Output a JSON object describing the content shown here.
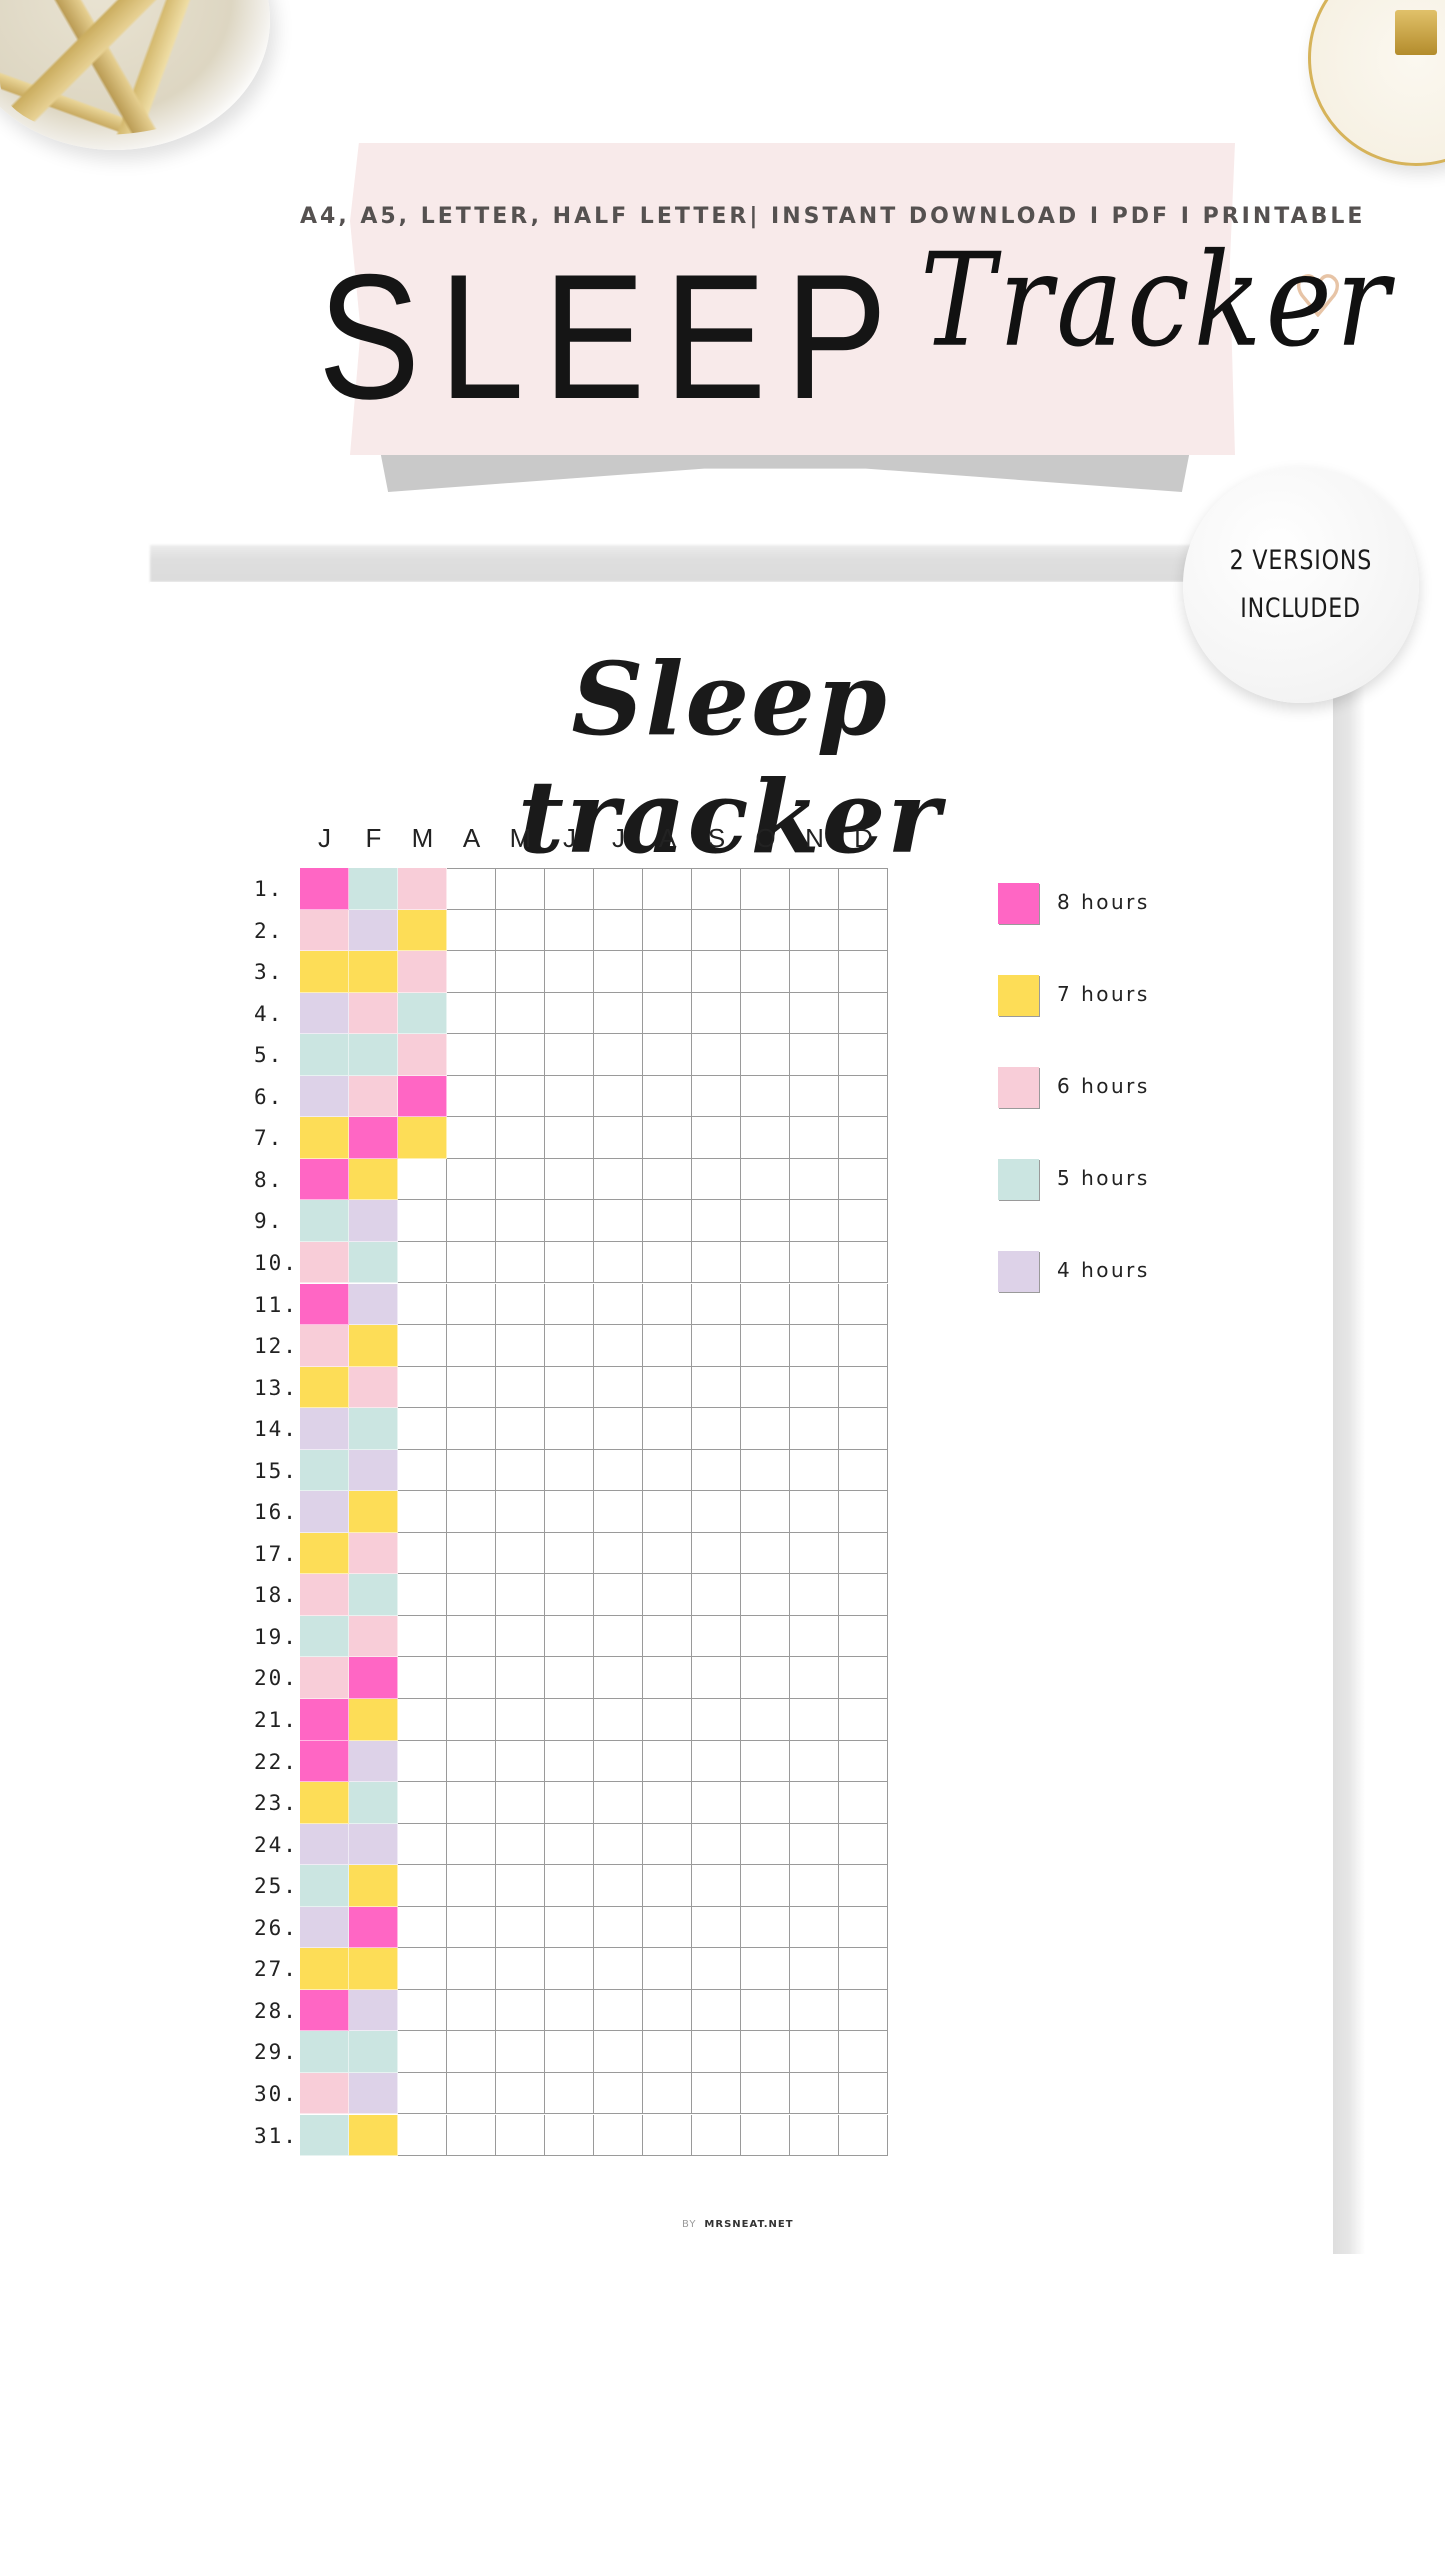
{
  "header": {
    "subtitle": "A4, A5, LETTER, HALF LETTER| INSTANT DOWNLOAD I PDF I PRINTABLE",
    "title_main": "SLEEP",
    "title_script": "Tracker"
  },
  "badge": {
    "line1": "2 Versions",
    "line2": "Included"
  },
  "decor": {
    "heart_icon": "♡"
  },
  "page": {
    "title": "Sleep tracker",
    "footer_by": "BY",
    "footer_brand": "MRSNEAT.NET"
  },
  "colors": {
    "8": "#ff66c4",
    "7": "#fddd57",
    "6": "#f8cdd8",
    "5": "#cbe5e1",
    "4": "#ddd2e8"
  },
  "chart_data": {
    "type": "heatmap",
    "title": "Sleep tracker",
    "xlabel": "",
    "ylabel": "",
    "categories": [
      "J",
      "F",
      "M",
      "A",
      "M",
      "J",
      "J",
      "A",
      "S",
      "O",
      "N",
      "D"
    ],
    "days": [
      "1.",
      "2.",
      "3.",
      "4.",
      "5.",
      "6.",
      "7.",
      "8.",
      "9.",
      "10.",
      "11.",
      "12.",
      "13.",
      "14.",
      "15.",
      "16.",
      "17.",
      "18.",
      "19.",
      "20.",
      "21.",
      "22.",
      "23.",
      "24.",
      "25.",
      "26.",
      "27.",
      "28.",
      "29.",
      "30.",
      "31."
    ],
    "legend": [
      {
        "value": 8,
        "label": "8 hours"
      },
      {
        "value": 7,
        "label": "7 hours"
      },
      {
        "value": 6,
        "label": "6 hours"
      },
      {
        "value": 5,
        "label": "5 hours"
      },
      {
        "value": 4,
        "label": "4 hours"
      }
    ],
    "legend_position": "right",
    "unit": "hours of sleep",
    "series": [
      {
        "name": "J",
        "values": [
          8,
          6,
          7,
          4,
          5,
          4,
          7,
          8,
          5,
          6,
          8,
          6,
          7,
          4,
          5,
          4,
          7,
          6,
          5,
          6,
          8,
          8,
          7,
          4,
          5,
          4,
          7,
          8,
          5,
          6,
          5
        ]
      },
      {
        "name": "F",
        "values": [
          5,
          4,
          7,
          6,
          5,
          6,
          8,
          7,
          4,
          5,
          4,
          7,
          6,
          5,
          4,
          7,
          6,
          5,
          6,
          8,
          7,
          4,
          5,
          4,
          7,
          8,
          7,
          4,
          5,
          4,
          7
        ]
      },
      {
        "name": "M",
        "values": [
          6,
          7,
          6,
          5,
          6,
          8,
          7,
          null,
          null,
          null,
          null,
          null,
          null,
          null,
          null,
          null,
          null,
          null,
          null,
          null,
          null,
          null,
          null,
          null,
          null,
          null,
          null,
          null,
          null,
          null,
          null
        ]
      },
      {
        "name": "A",
        "values": []
      },
      {
        "name": "M",
        "values": []
      },
      {
        "name": "J",
        "values": []
      },
      {
        "name": "J",
        "values": []
      },
      {
        "name": "A",
        "values": []
      },
      {
        "name": "S",
        "values": []
      },
      {
        "name": "O",
        "values": []
      },
      {
        "name": "N",
        "values": []
      },
      {
        "name": "D",
        "values": []
      }
    ]
  }
}
